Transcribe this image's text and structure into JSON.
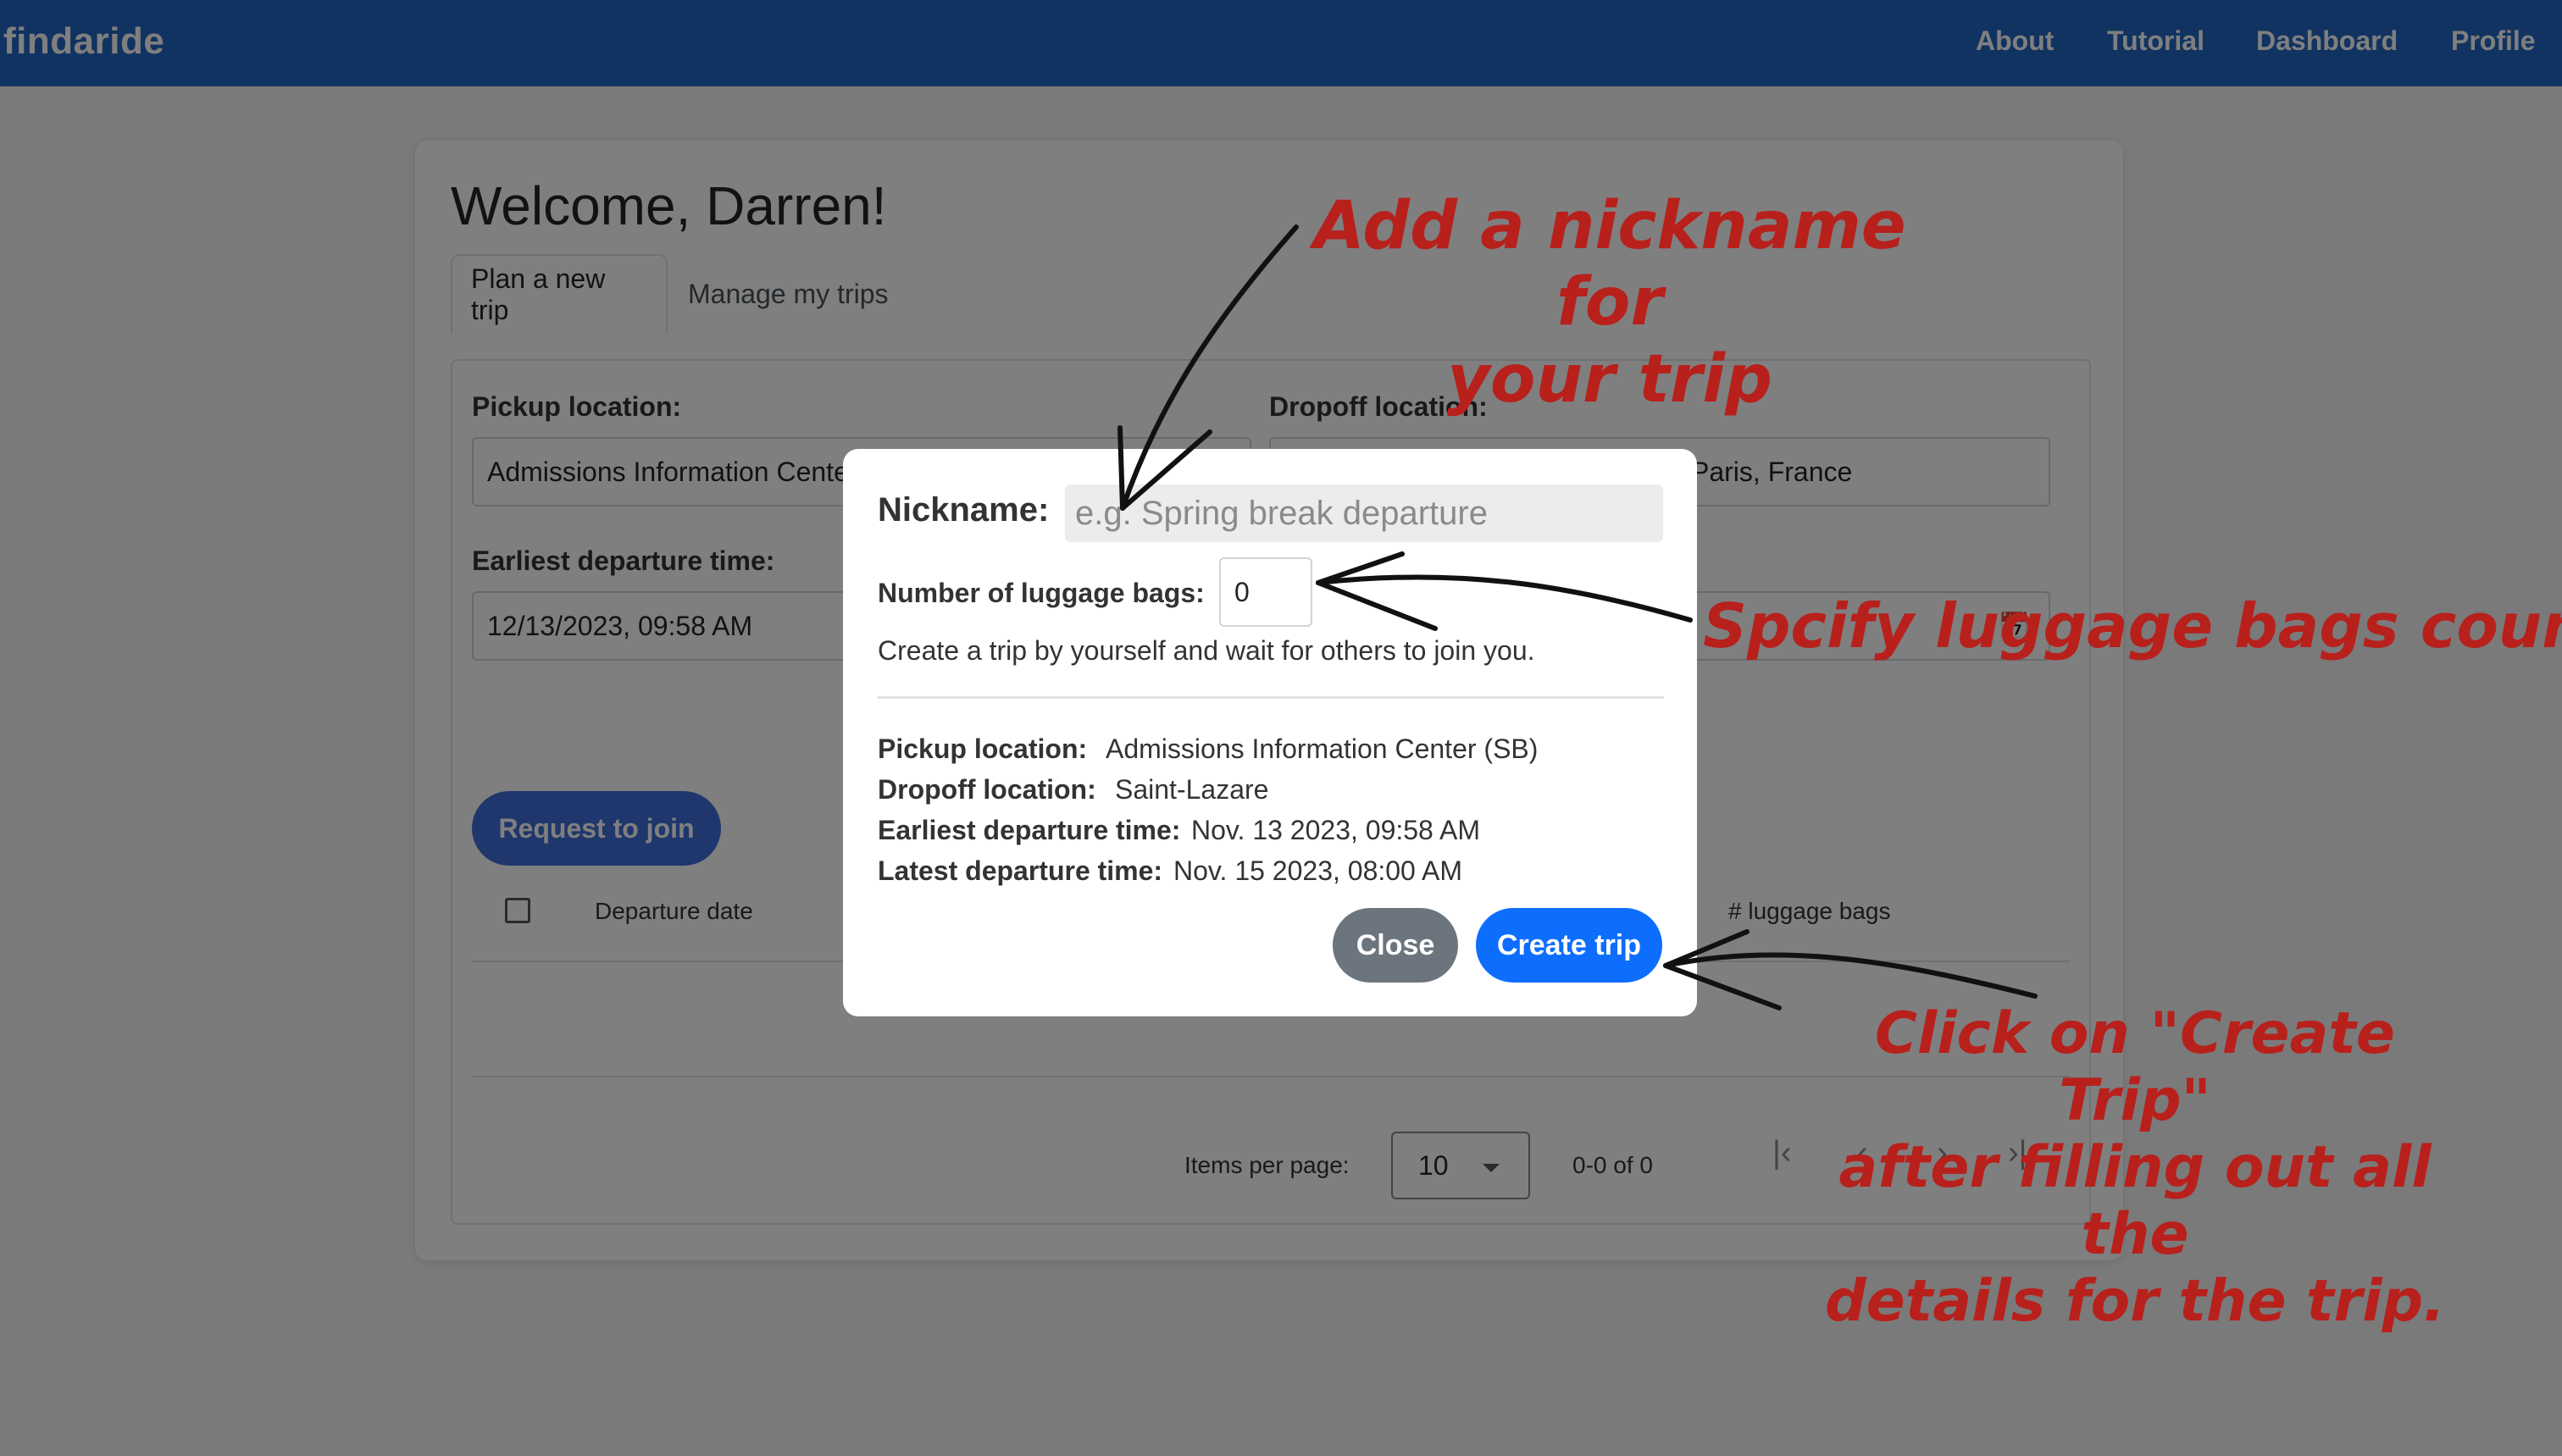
{
  "navbar": {
    "brand": "findaride",
    "links": [
      "About",
      "Tutorial",
      "Dashboard",
      "Profile"
    ]
  },
  "page": {
    "welcome": "Welcome, Darren!",
    "tabs": [
      "Plan a new trip",
      "Manage my trips"
    ],
    "pickup_label": "Pickup location:",
    "pickup_value": "Admissions Information Cente",
    "dropoff_label": "Dropoff location:",
    "dropoff_value": "Paris, France",
    "earliest_label": "Earliest departure time:",
    "earliest_value": "12/13/2023, 09:58 AM",
    "request_button": "Request to join",
    "table_headers": {
      "departure_date": "Departure date",
      "luggage": "# luggage bags"
    },
    "pagination": {
      "items_per_page_label": "Items per page:",
      "items_per_page_value": "10",
      "range": "0-0 of 0"
    }
  },
  "modal": {
    "nickname_label": "Nickname:",
    "nickname_placeholder": "e.g. Spring break departure",
    "luggage_label": "Number of luggage bags:",
    "luggage_value": "0",
    "helper_text": "Create a trip by yourself and wait for others to join you.",
    "details": {
      "pickup_label": "Pickup location:",
      "pickup_value": "Admissions Information Center (SB)",
      "dropoff_label": "Dropoff location:",
      "dropoff_value": "Saint-Lazare",
      "earliest_label": "Earliest departure time:",
      "earliest_value": "Nov. 13 2023, 09:58 AM",
      "latest_label": "Latest departure time:",
      "latest_value": "Nov. 15 2023, 08:00 AM"
    },
    "close_button": "Close",
    "create_button": "Create trip"
  },
  "annotations": {
    "nickname_line1": "Add a nickname for",
    "nickname_line2": "your trip",
    "luggage": "Spcify luggage bags count",
    "create_line1": "Click on \"Create Trip\"",
    "create_line2": "after filling out all the",
    "create_line3": "details for the trip."
  },
  "colors": {
    "navbar": "#2366c3",
    "primary_button": "#0d6efd",
    "secondary_button": "#6c757d",
    "annotation_text": "#b8201c"
  }
}
